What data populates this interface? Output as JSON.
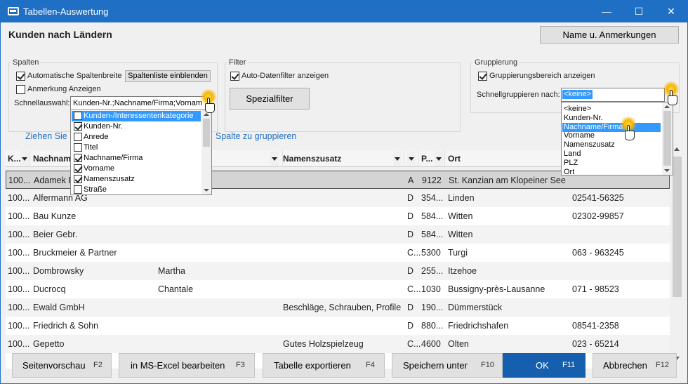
{
  "window": {
    "title": "Tabellen-Auswertung",
    "minimize": "—",
    "maximize": "☐",
    "close": "✕"
  },
  "page_title": "Kunden nach Ländern",
  "name_button": "Name u. Anmerkungen",
  "spalten": {
    "legend": "Spalten",
    "auto_width": "Automatische Spaltenbreite",
    "auto_width_checked": true,
    "show_list_button": "Spaltenliste einblenden",
    "annotation": "Anmerkung Anzeigen",
    "annotation_checked": false,
    "quick_label": "Schnellauswahl:",
    "quick_value": "Kunden-Nr.;Nachname/Firma;Vornam"
  },
  "filter": {
    "legend": "Filter",
    "auto_filter": "Auto-Datenfilter anzeigen",
    "auto_filter_checked": true,
    "special_button": "Spezialfilter"
  },
  "gruppierung": {
    "legend": "Gruppierung",
    "show_area": "Gruppierungsbereich anzeigen",
    "show_area_checked": true,
    "quick_label": "Schnellgruppieren nach:",
    "quick_value": "<keine>"
  },
  "group_hint": "Ziehen Sie eine Spalte hierher, um nach dieser Spalte zu gruppieren",
  "group_hint_left": "Ziehen Sie",
  "group_hint_right": "Spalte zu gruppieren",
  "columns": [
    {
      "label": "K..."
    },
    {
      "label": "Nachname"
    },
    {
      "label": ""
    },
    {
      "label": "Namenszusatz"
    },
    {
      "label": ""
    },
    {
      "label": "P..."
    },
    {
      "label": "Ort"
    }
  ],
  "rows": [
    {
      "knr": "100...",
      "name": "Adamek P",
      "vorname": "",
      "zusatz": "",
      "land": "A",
      "plz": "9122",
      "ort": "St. Kanzian am Klopeiner See",
      "tel": ""
    },
    {
      "knr": "100...",
      "name": "Alfermann AG",
      "vorname": "",
      "zusatz": "",
      "land": "D",
      "plz": "354...",
      "ort": "Linden",
      "tel": "02541-56325"
    },
    {
      "knr": "100...",
      "name": "Bau Kunze",
      "vorname": "",
      "zusatz": "",
      "land": "D",
      "plz": "584...",
      "ort": "Witten",
      "tel": "02302-99857"
    },
    {
      "knr": "100...",
      "name": "Beier Gebr.",
      "vorname": "",
      "zusatz": "",
      "land": "D",
      "plz": "584...",
      "ort": "Witten",
      "tel": ""
    },
    {
      "knr": "100...",
      "name": "Bruckmeier & Partner",
      "vorname": "",
      "zusatz": "",
      "land": "C...",
      "plz": "5300",
      "ort": "Turgi",
      "tel": "063 - 963245"
    },
    {
      "knr": "100...",
      "name": "Dombrowsky",
      "vorname": "Martha",
      "zusatz": "",
      "land": "D",
      "plz": "255...",
      "ort": "Itzehoe",
      "tel": ""
    },
    {
      "knr": "100...",
      "name": "Ducrocq",
      "vorname": "Chantale",
      "zusatz": "",
      "land": "C...",
      "plz": "1030",
      "ort": "Bussigny-près-Lausanne",
      "tel": "071 - 98523"
    },
    {
      "knr": "100...",
      "name": "Ewald GmbH",
      "vorname": "",
      "zusatz": "Beschläge, Schrauben, Profile",
      "land": "D",
      "plz": "190...",
      "ort": "Dümmerstück",
      "tel": ""
    },
    {
      "knr": "100...",
      "name": "Friedrich & Sohn",
      "vorname": "",
      "zusatz": "",
      "land": "D",
      "plz": "880...",
      "ort": "Friedrichshafen",
      "tel": "08541-2358"
    },
    {
      "knr": "100...",
      "name": "Gepetto",
      "vorname": "",
      "zusatz": "Gutes Holzspielzeug",
      "land": "C...",
      "plz": "4600",
      "ort": "Olten",
      "tel": "023 - 65214"
    }
  ],
  "column_dropdown": [
    {
      "label": "Kunden-/Interessentenkategorie",
      "checked": false
    },
    {
      "label": "Kunden-Nr.",
      "checked": true
    },
    {
      "label": "Anrede",
      "checked": false
    },
    {
      "label": "Titel",
      "checked": false
    },
    {
      "label": "Nachname/Firma",
      "checked": true
    },
    {
      "label": "Vorname",
      "checked": true
    },
    {
      "label": "Namenszusatz",
      "checked": true
    },
    {
      "label": "Straße",
      "checked": false
    }
  ],
  "group_dropdown": [
    "<keine>",
    "Kunden-Nr.",
    "Nachname/Firma",
    "Vorname",
    "Namenszusatz",
    "Land",
    "PLZ",
    "Ort"
  ],
  "group_dropdown_selected": "Nachname/Firma",
  "buttons": {
    "preview": "Seitenvorschau",
    "preview_key": "F2",
    "excel": "in MS-Excel bearbeiten",
    "excel_key": "F3",
    "export": "Tabelle exportieren",
    "export_key": "F4",
    "save": "Speichern unter",
    "save_key": "F10",
    "ok": "OK",
    "ok_key": "F11",
    "cancel": "Abbrechen",
    "cancel_key": "F12"
  },
  "colors": {
    "accent": "#1f6fc5",
    "ok_button": "#165eae",
    "selection": "#3399ff"
  }
}
